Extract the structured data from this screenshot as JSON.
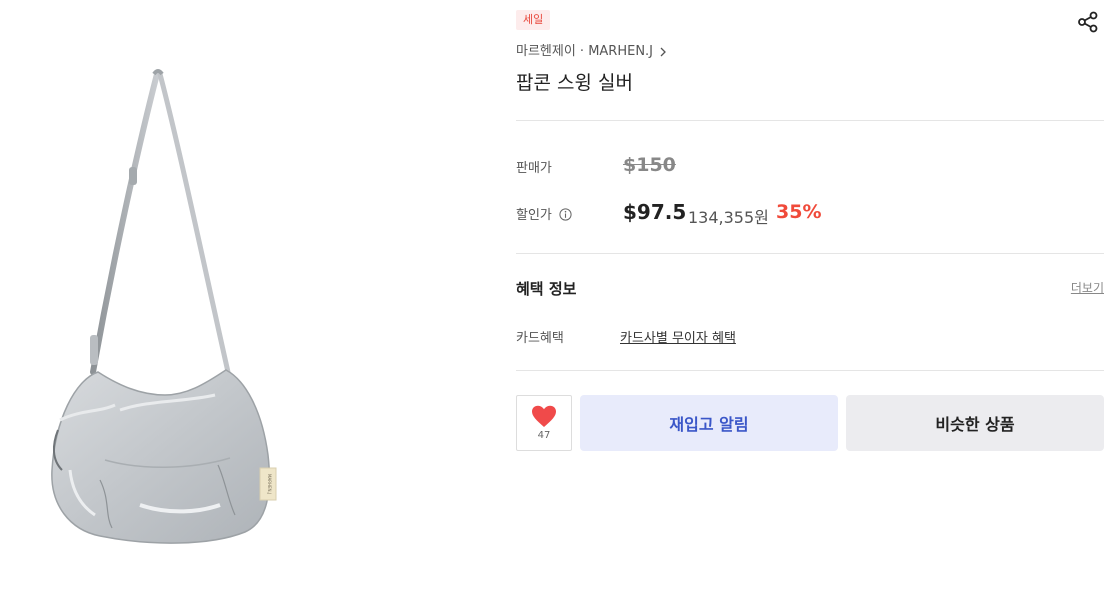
{
  "product": {
    "badge": "세일",
    "brand": "마르헨제이 · MARHEN.J",
    "title": "팝콘 스윙 실버",
    "image_alt": "팝콘 스윙 실버 가방 이미지",
    "bag_label": "MARHEN.J"
  },
  "price": {
    "original_label": "판매가",
    "original": "$150",
    "sale_label": "할인가",
    "sale": "$97.5",
    "sale_krw": "134,355원",
    "discount": "35%"
  },
  "benefits": {
    "title": "혜택 정보",
    "more": "더보기",
    "card_label": "카드혜택",
    "card_value": "카드사별 무이자 혜택"
  },
  "actions": {
    "like_count": "47",
    "restock": "재입고 알림",
    "similar": "비슷한 상품"
  },
  "colors": {
    "discount": "#f04a3a",
    "badge_text": "#e8473b",
    "heart": "#f04a4a",
    "restock_bg": "#e8ebfb",
    "restock_text": "#3a56c8"
  },
  "icons": {
    "share": "share-icon",
    "chevron": "chevron-right-icon",
    "info": "info-icon",
    "heart": "heart-icon"
  }
}
